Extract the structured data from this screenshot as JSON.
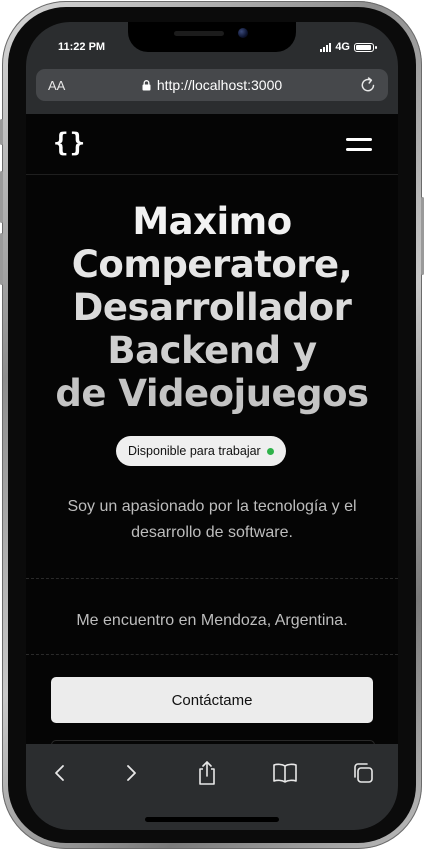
{
  "status_bar": {
    "time": "11:22 PM",
    "network": "4G",
    "icons": [
      "signal-icon",
      "battery-icon"
    ]
  },
  "browser": {
    "text_size_label": "AA",
    "url": "http://localhost:3000",
    "icons": [
      "lock-icon",
      "reload-icon"
    ]
  },
  "site": {
    "logo": "{}",
    "menu_icon": "hamburger-menu-icon",
    "hero": {
      "lines": [
        "Maximo",
        "Comperatore,",
        "Desarrollador",
        "Backend y",
        "de Videojuegos"
      ]
    },
    "availability_badge": {
      "label": "Disponible para trabajar",
      "dot_color": "#2fb24a"
    },
    "intro": "Soy un apasionado por la tecnología y el desarrollo de software.",
    "location": "Me encuentro en Mendoza, Argentina.",
    "cta_label": "Contáctame"
  },
  "toolbar": {
    "icons": [
      "back-icon",
      "forward-icon",
      "share-icon",
      "bookmarks-icon",
      "tabs-icon"
    ]
  },
  "colors": {
    "page_background": "#050505",
    "browser_chrome": "#2b2d2f",
    "url_field": "#46484b",
    "button_background": "#ececec",
    "available_dot": "#2fb24a"
  }
}
